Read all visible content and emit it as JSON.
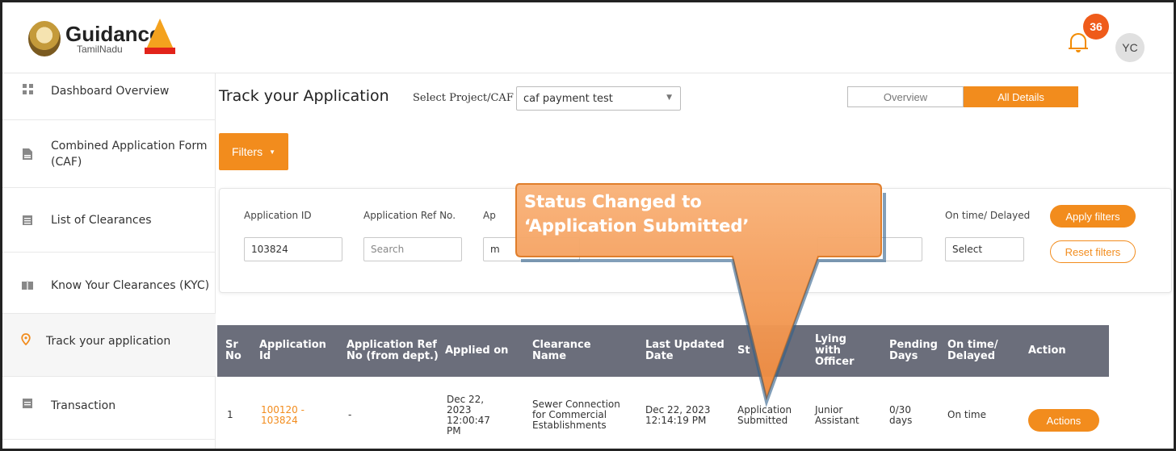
{
  "header": {
    "logo_title": "Guidance",
    "logo_subtitle": "TamilNadu",
    "notification_count": "36",
    "avatar_initials": "YC"
  },
  "sidebar": {
    "items": [
      {
        "label": "Dashboard Overview",
        "icon": "dashboard-icon"
      },
      {
        "label": "Combined Application Form (CAF)",
        "icon": "document-icon"
      },
      {
        "label": "List of Clearances",
        "icon": "list-icon"
      },
      {
        "label": "Know Your Clearances (KYC)",
        "icon": "book-icon"
      },
      {
        "label": "Track your application",
        "icon": "location-pin-icon"
      },
      {
        "label": "Transaction",
        "icon": "transaction-icon"
      }
    ]
  },
  "main": {
    "title": "Track your Application",
    "select_label": "Select Project/CAF",
    "select_value": "caf payment test",
    "toggle_overview": "Overview",
    "toggle_all_details": "All Details",
    "filters_label": "Filters"
  },
  "filters": {
    "app_id_label": "Application ID",
    "app_id_value": "103824",
    "ref_label": "Application Ref No.",
    "ref_placeholder": "Search",
    "third_label": "Ap",
    "third_value": "m",
    "ontime_label": "On time/ Delayed",
    "ontime_value": "Select",
    "apply_label": "Apply filters",
    "reset_label": "Reset filters"
  },
  "table": {
    "headers": {
      "sr": "Sr No",
      "app_id": "Application Id",
      "ref": "Application Ref No (from dept.)",
      "applied": "Applied on",
      "clearance": "Clearance Name",
      "updated": "Last Updated Date",
      "status": "St",
      "officer": "Lying with Officer",
      "pending": "Pending Days",
      "ontime": "On time/ Delayed",
      "action": "Action"
    },
    "rows": [
      {
        "sr": "1",
        "app_id": "100120 - 103824",
        "ref": "-",
        "applied": "Dec 22, 2023 12:00:47 PM",
        "clearance": "Sewer Connection for Commercial Establishments",
        "updated": "Dec 22, 2023 12:14:19 PM",
        "status": "Application Submitted",
        "officer": "Junior Assistant",
        "pending": "0/30 days",
        "ontime": "On time",
        "action": "Actions"
      }
    ]
  },
  "callout": {
    "line1": "Status Changed to",
    "line2": "‘Application Submitted’"
  },
  "colors": {
    "accent": "#f28c1d",
    "table_header": "#6b6e7b",
    "badge": "#ef5b1a"
  }
}
